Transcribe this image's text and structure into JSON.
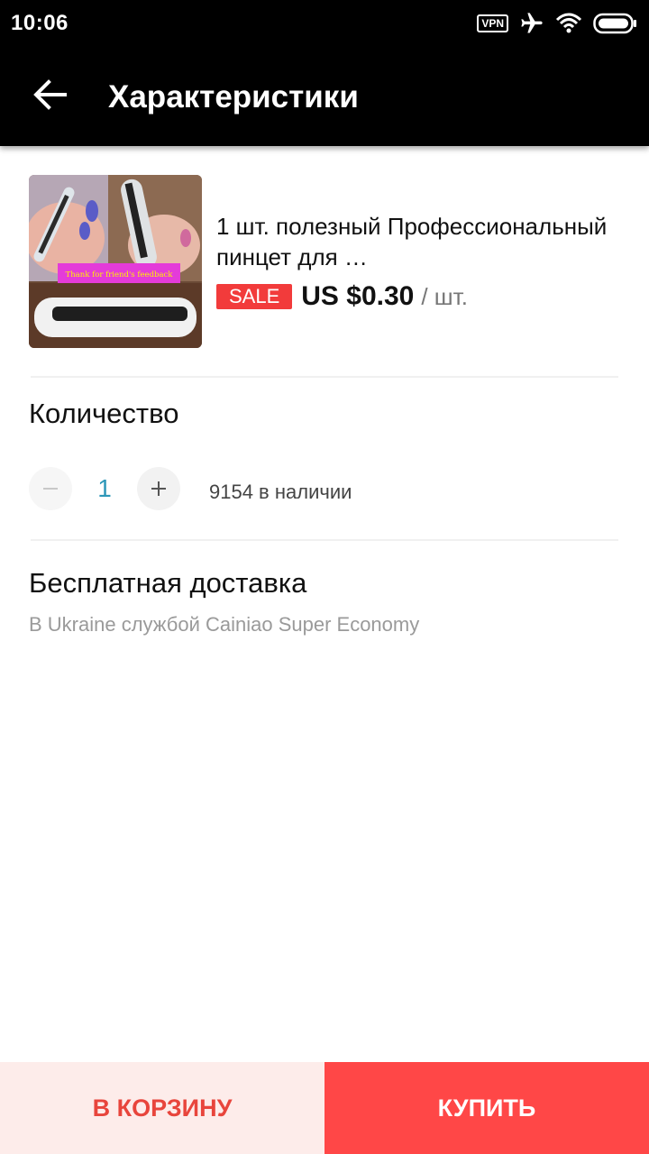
{
  "status_bar": {
    "time": "10:06",
    "vpn": "VPN",
    "icons": [
      "vpn-icon",
      "airplane-icon",
      "wifi-icon",
      "battery-icon"
    ]
  },
  "header": {
    "title": "Характеристики",
    "back_icon": "back-arrow-icon"
  },
  "product": {
    "image_caption": "Thank for friend's feedback",
    "title": "1 шт. полезный Профессиональный пинцет для …",
    "sale_badge": "SALE",
    "price": "US $0.30",
    "price_unit": "/ шт."
  },
  "quantity": {
    "label": "Количество",
    "minus": "−",
    "value": "1",
    "plus": "+",
    "stock": "9154 в наличии"
  },
  "shipping": {
    "title": "Бесплатная доставка",
    "subtitle": "В Ukraine службой Cainiao Super Economy"
  },
  "actions": {
    "add_to_cart": "В КОРЗИНУ",
    "buy": "КУПИТЬ"
  },
  "colors": {
    "sale": "#f23b3b",
    "buy_button": "#ff4747",
    "cart_button_bg": "#fdecea",
    "cart_button_text": "#e8453c",
    "quantity_value": "#2d97b8"
  }
}
